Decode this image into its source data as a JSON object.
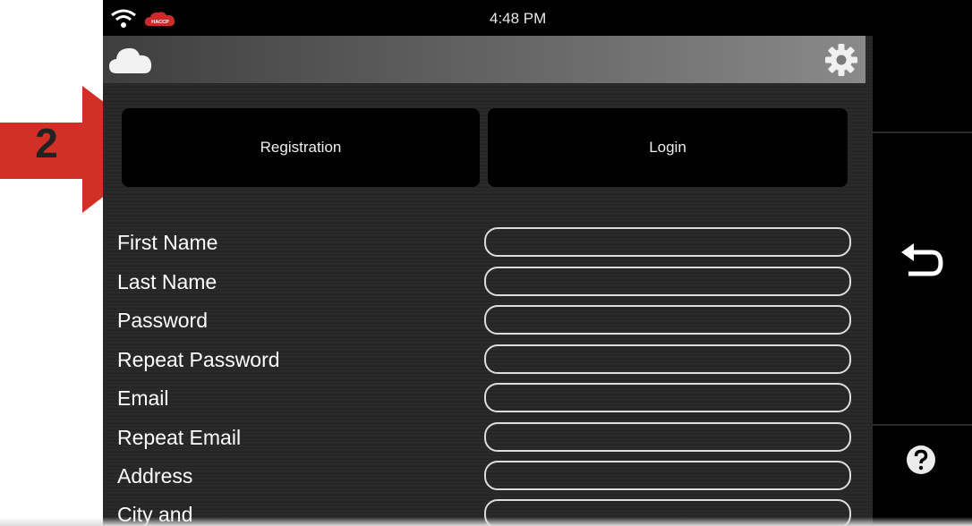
{
  "annotation": {
    "step_number": "2"
  },
  "statusbar": {
    "time": "4:48 PM",
    "badge_text": "HACCP"
  },
  "tabs": {
    "registration": "Registration",
    "login": "Login"
  },
  "form": {
    "fields": [
      {
        "label": "First Name",
        "value": ""
      },
      {
        "label": "Last Name",
        "value": ""
      },
      {
        "label": "Password",
        "value": ""
      },
      {
        "label": "Repeat Password",
        "value": ""
      },
      {
        "label": "Email",
        "value": ""
      },
      {
        "label": "Repeat Email",
        "value": ""
      },
      {
        "label": "Address",
        "value": ""
      },
      {
        "label": "City and",
        "value": ""
      }
    ]
  },
  "colors": {
    "arrow": "#d22f27",
    "haccp_badge": "#cc2b2b",
    "background": "#000000"
  },
  "icons": {
    "cloud": "cloud-icon",
    "settings": "gear-icon",
    "back": "back-arrow-icon",
    "help": "help-icon",
    "wifi": "wifi-icon"
  }
}
